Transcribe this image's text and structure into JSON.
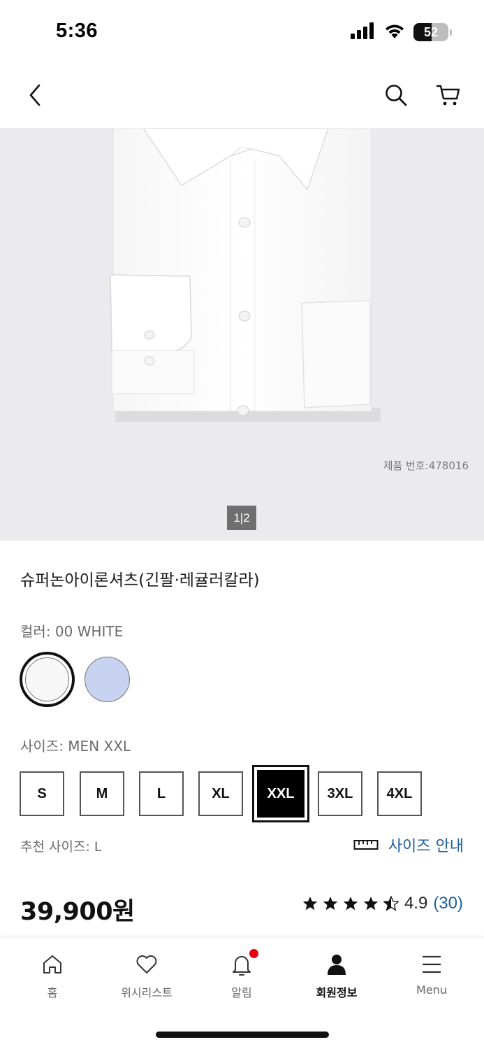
{
  "status_bar": {
    "time": "5:36",
    "battery_percent": 52,
    "battery_label": "52",
    "signal_icon": "cellular-signal-icon",
    "wifi_icon": "wifi-icon"
  },
  "header": {
    "back_icon": "chevron-left-icon",
    "search_icon": "search-icon",
    "cart_icon": "cart-icon"
  },
  "gallery": {
    "product_number": "제품 번호:478016",
    "pager_current": "1",
    "pager_total": "2",
    "pager_text": "1|2"
  },
  "product": {
    "title": "슈퍼논아이론셔츠(긴팔·레귤러칼라)",
    "color_label": "컬러: 00 WHITE",
    "colors": [
      {
        "name": "WHITE",
        "hex": "#f7f7f7",
        "selected": true
      },
      {
        "name": "BLUE",
        "hex": "#c7d3f1",
        "selected": false
      }
    ],
    "size_label": "사이즈: MEN XXL",
    "sizes": [
      "S",
      "M",
      "L",
      "XL",
      "XXL",
      "3XL",
      "4XL"
    ],
    "selected_size": "XXL",
    "recommended_size": "추천 사이즈: L",
    "size_guide_label": "사이즈 안내",
    "size_guide_icon": "ruler-icon",
    "price": "39,900원",
    "rating_value": "4.9",
    "rating_count": "(30)",
    "rating_stars": 4.5
  },
  "tab_bar": {
    "items": [
      {
        "label": "홈",
        "icon": "home-icon"
      },
      {
        "label": "위시리스트",
        "icon": "heart-icon"
      },
      {
        "label": "알림",
        "icon": "bell-icon"
      },
      {
        "label": "회원정보",
        "icon": "person-icon"
      },
      {
        "label": "Menu",
        "icon": "menu-icon"
      }
    ],
    "active_index": 3
  },
  "colors": {
    "link_blue": "#1f5fa0",
    "badge_red": "#e60012",
    "hero_bg": "#ebebed"
  }
}
